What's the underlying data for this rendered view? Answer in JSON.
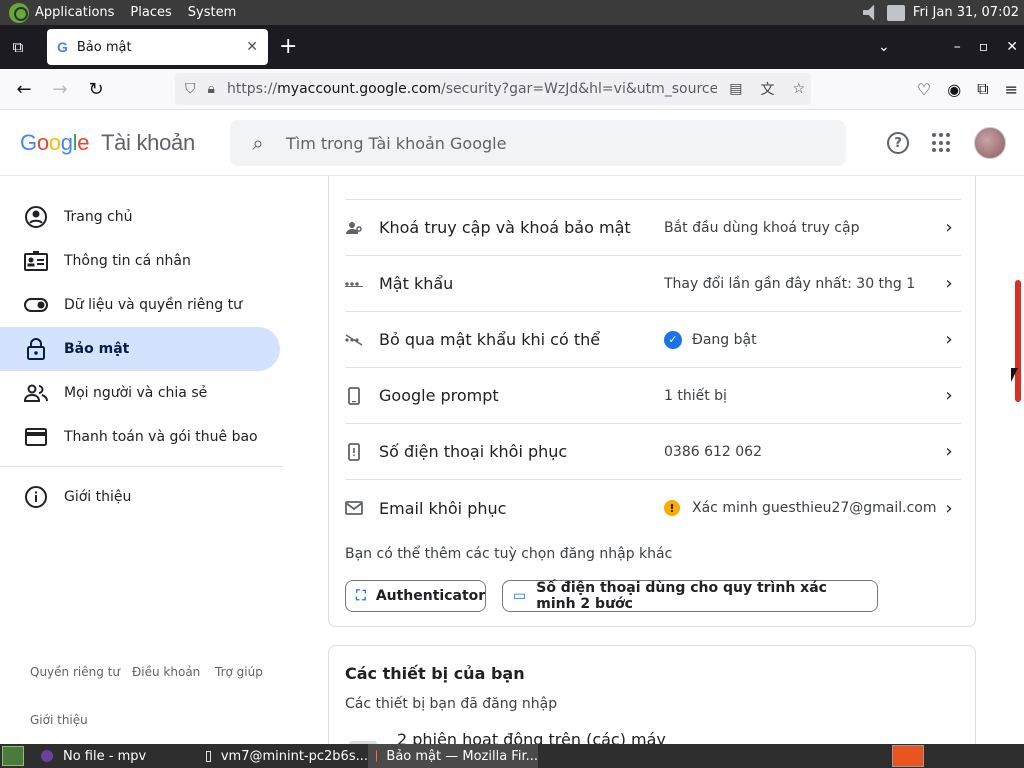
{
  "os_panel": {
    "menus": [
      "Applications",
      "Places",
      "System"
    ],
    "clock": "Fri Jan 31, 07:02"
  },
  "browser": {
    "tab_title": "Bảo mật",
    "url_host": "myaccount.google.com",
    "url_prefix": "https://",
    "url_rest": "/security?gar=WzJd&hl=vi&utm_source=OGB&"
  },
  "header": {
    "logo_letters": [
      "G",
      "o",
      "o",
      "g",
      "l",
      "e"
    ],
    "account_label": "Tài khoản",
    "search_placeholder": "Tìm trong Tài khoản Google",
    "help_glyph": "?"
  },
  "sidebar": {
    "items": [
      {
        "label": "Trang chủ",
        "icon": "account-circle-icon"
      },
      {
        "label": "Thông tin cá nhân",
        "icon": "id-card-icon"
      },
      {
        "label": "Dữ liệu và quyền riêng tư",
        "icon": "toggle-icon"
      },
      {
        "label": "Bảo mật",
        "icon": "lock-icon",
        "active": true
      },
      {
        "label": "Mọi người và chia sẻ",
        "icon": "people-icon"
      },
      {
        "label": "Thanh toán và gói thuê bao",
        "icon": "credit-card-icon"
      },
      {
        "label": "Giới thiệu",
        "icon": "info-icon"
      }
    ],
    "footer_links": [
      "Quyền riêng tư",
      "Điều khoản",
      "Trợ giúp"
    ],
    "footer_about": "Giới thiệu"
  },
  "security": {
    "rows": [
      {
        "title": "Khoá truy cập và khoá bảo mật",
        "value": "Bắt đầu dùng khoá truy cập",
        "icon": "passkey-icon"
      },
      {
        "title": "Mật khẩu",
        "value": "Thay đổi lần gần đây nhất: 30 thg 1",
        "icon": "password-icon"
      },
      {
        "title": "Bỏ qua mật khẩu khi có thể",
        "value": "Đang bật",
        "icon": "skip-password-icon",
        "status": "ok"
      },
      {
        "title": "Google prompt",
        "value": "1 thiết bị",
        "icon": "phone-icon"
      },
      {
        "title": "Số điện thoại khôi phục",
        "value": "0386 612 062",
        "icon": "phone-alert-icon"
      },
      {
        "title": "Email khôi phục",
        "value": "Xác minh guesthieu27@gmail.com",
        "icon": "mail-icon",
        "status": "warning"
      }
    ],
    "more_options_text": "Bạn có thể thêm các tuỳ chọn đăng nhập khác",
    "chips": [
      "Authenticator",
      "Số điện thoại dùng cho quy trình xác minh 2 bước"
    ]
  },
  "devices": {
    "title": "Các thiết bị của bạn",
    "subtitle": "Các thiết bị bạn đã đăng nhập",
    "sessions": "2 phiên hoạt động trên (các) máy"
  },
  "taskbar": {
    "items": [
      "No file - mpv",
      "vm7@minint-pc2b6s...",
      "Bảo mật — Mozilla Fir..."
    ]
  },
  "colors": {
    "accent": "#1a73e8",
    "active_nav": "#d3e3fd",
    "warning": "#f9ab00",
    "scroll_thumb": "#d93025"
  }
}
